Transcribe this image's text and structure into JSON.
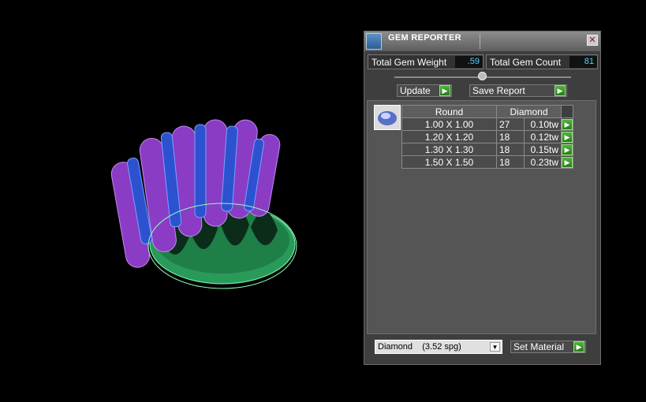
{
  "panel": {
    "title": "GEM REPORTER",
    "total_weight_label": "Total Gem Weight",
    "total_weight_value": ".59",
    "total_count_label": "Total Gem Count",
    "total_count_value": "81",
    "update_label": "Update",
    "save_report_label": "Save Report",
    "table": {
      "headers": [
        "Round",
        "Diamond"
      ],
      "rows": [
        {
          "size": "1.00 X 1.00",
          "count": "27",
          "tw": "0.10tw"
        },
        {
          "size": "1.20 X 1.20",
          "count": "18",
          "tw": "0.12tw"
        },
        {
          "size": "1.30 X 1.30",
          "count": "18",
          "tw": "0.15tw"
        },
        {
          "size": "1.50 X 1.50",
          "count": "18",
          "tw": "0.23tw"
        }
      ]
    },
    "material_select": "Diamond    (3.52 spg)",
    "set_material_label": "Set Material"
  },
  "icons": {
    "close": "close-icon",
    "play": "play-arrow-icon",
    "app": "gem-reporter-icon",
    "gem": "round-gem-icon",
    "dropdown": "chevron-down-icon"
  },
  "colors": {
    "accent_green": "#3ea02c",
    "value_cyan": "#4fd5ff",
    "ring_gems_purple": "#8a3cc4",
    "ring_body_green": "#3fcf7a"
  }
}
